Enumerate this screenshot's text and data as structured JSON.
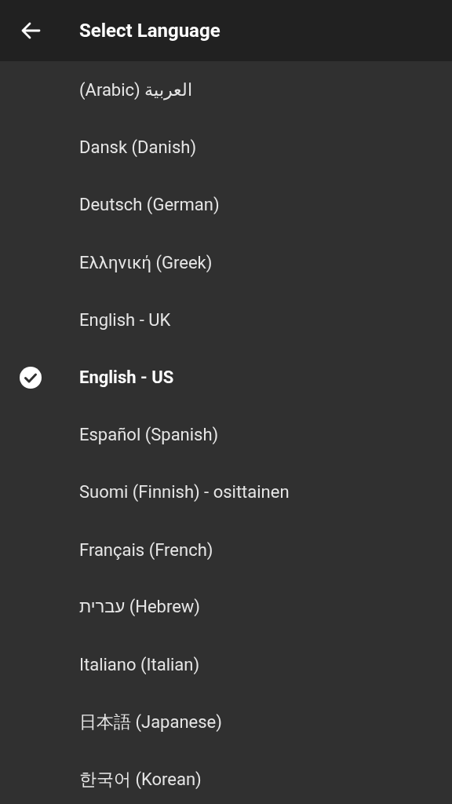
{
  "header": {
    "title": "Select Language"
  },
  "languages": [
    {
      "label": "(Arabic) العربية",
      "selected": false
    },
    {
      "label": "Dansk (Danish)",
      "selected": false
    },
    {
      "label": "Deutsch (German)",
      "selected": false
    },
    {
      "label": "Ελληνική (Greek)",
      "selected": false
    },
    {
      "label": "English - UK",
      "selected": false
    },
    {
      "label": "English - US",
      "selected": true
    },
    {
      "label": "Español (Spanish)",
      "selected": false
    },
    {
      "label": "Suomi (Finnish) - osittainen",
      "selected": false
    },
    {
      "label": "Français (French)",
      "selected": false
    },
    {
      "label": "עברית (Hebrew)",
      "selected": false
    },
    {
      "label": "Italiano (Italian)",
      "selected": false
    },
    {
      "label": "日本語 (Japanese)",
      "selected": false
    },
    {
      "label": "한국어 (Korean)",
      "selected": false
    }
  ]
}
